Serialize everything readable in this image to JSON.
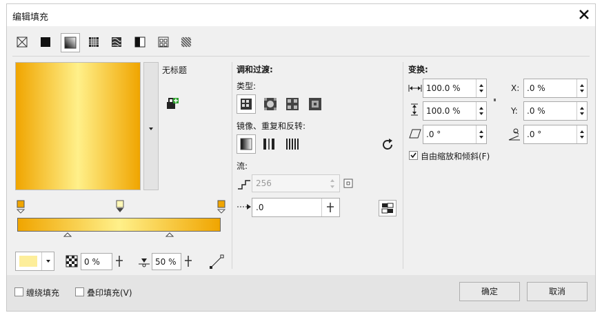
{
  "title": "编辑填充",
  "fill_types": [
    "no-fill",
    "uniform-fill",
    "fountain-fill",
    "vector-pattern-fill",
    "bitmap-pattern-fill",
    "two-color-pattern-fill",
    "texture-fill",
    "postscript-fill"
  ],
  "preview": {
    "name": "无标题"
  },
  "blend": {
    "heading": "调和过渡:",
    "type_label": "类型:",
    "mirror_label": "镜像、重复和反转:",
    "flow_label": "流:",
    "steps_value": "256",
    "accel_value": ".0"
  },
  "transform": {
    "heading": "变换:",
    "width": "100.0 %",
    "height": "100.0 %",
    "skew": ".0 °",
    "x_label": "X:",
    "x": ".0 %",
    "y_label": "Y:",
    "y": ".0 %",
    "rotate": ".0 °",
    "free_scale": "自由缩放和倾斜(F)",
    "free_scale_checked": true
  },
  "node": {
    "transparency": "0 %",
    "position": "50 %",
    "color": "#fdee9a"
  },
  "gradient": {
    "stops": [
      "#f0a500",
      "#fff08a",
      "#f0a500"
    ]
  },
  "footer": {
    "wrap_fill": "缠绕填充",
    "overprint": "叠印填充(V)",
    "ok": "确定",
    "cancel": "取消"
  }
}
